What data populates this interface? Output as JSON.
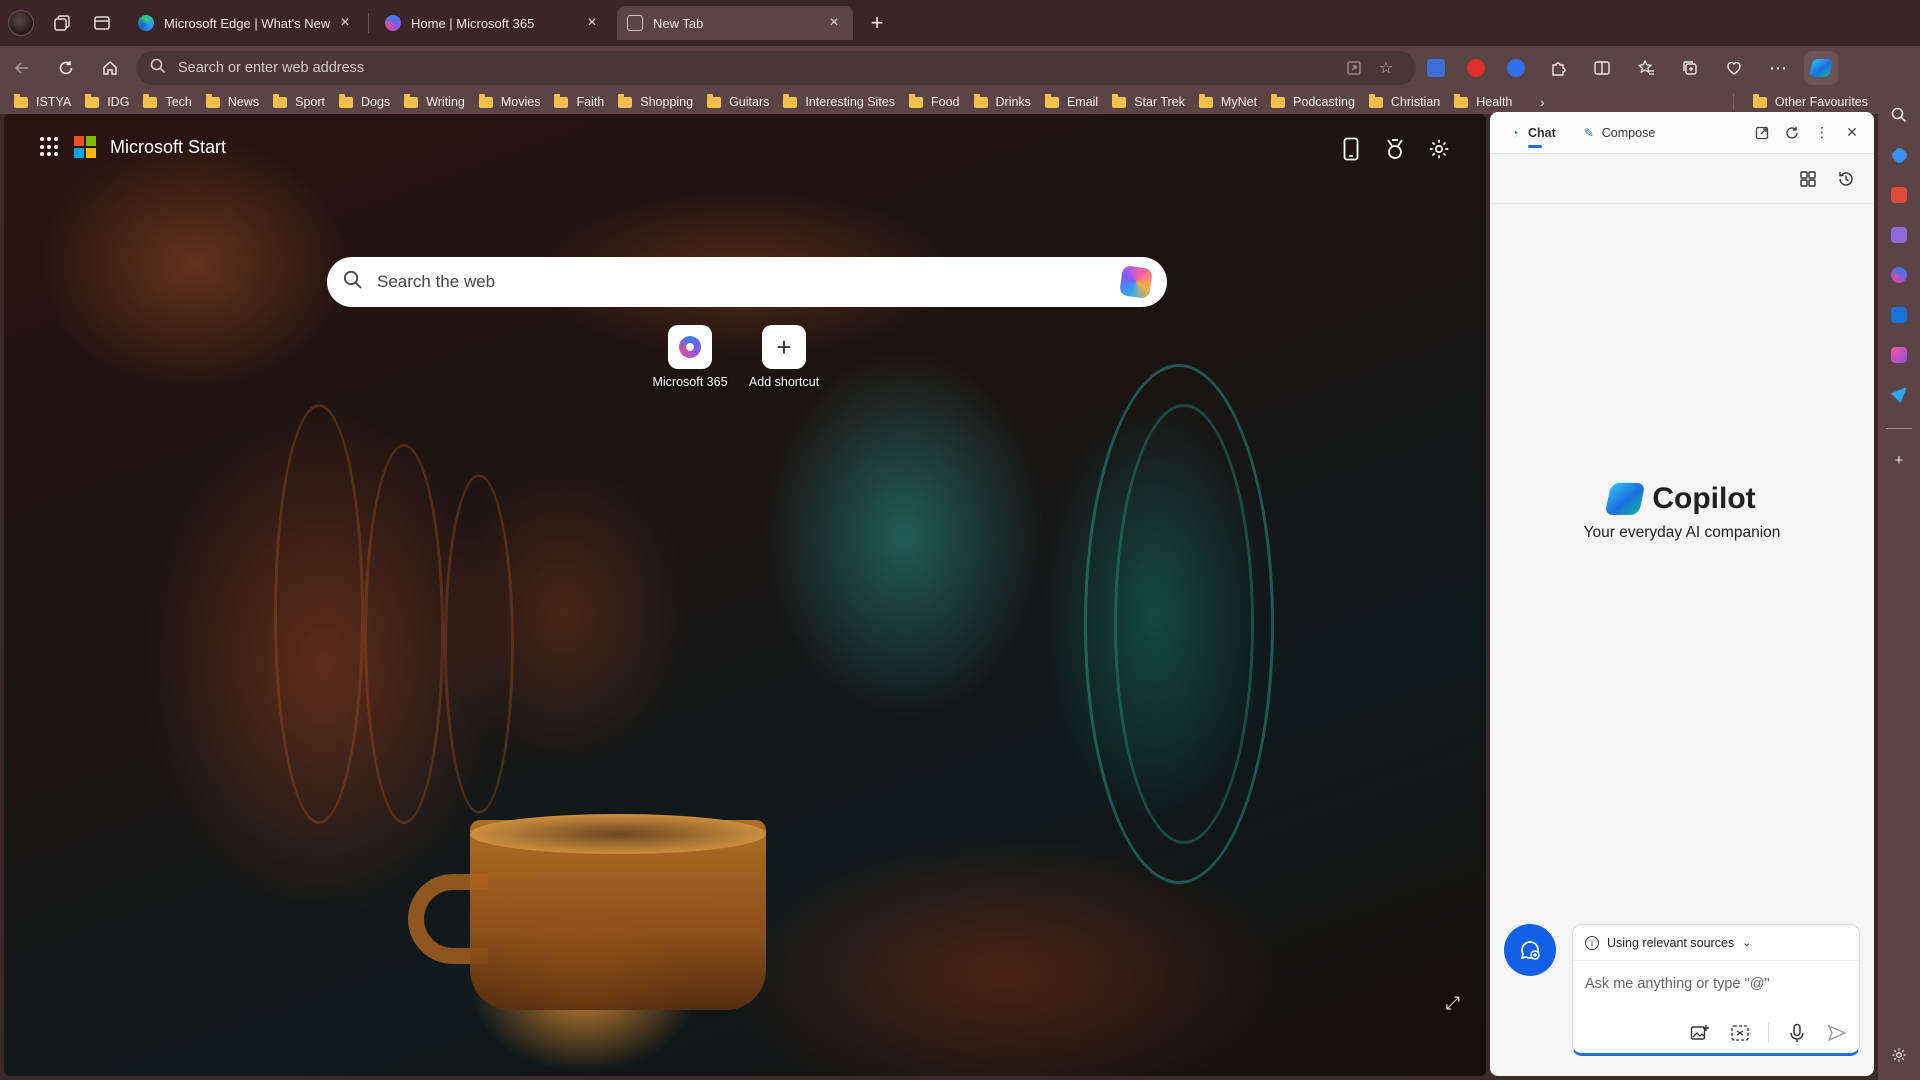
{
  "tabs": [
    {
      "title": "Microsoft Edge | What's New",
      "favicon_color": "#2e9bf0",
      "active": false
    },
    {
      "title": "Home | Microsoft 365",
      "favicon_color": "#7b6cf6",
      "active": false
    },
    {
      "title": "New Tab",
      "favicon_color": "#cfc3c3",
      "active": true
    }
  ],
  "address_bar": {
    "placeholder": "Search or enter web address"
  },
  "favourites": [
    "ISTYA",
    "IDG",
    "Tech",
    "News",
    "Sport",
    "Dogs",
    "Writing",
    "Movies",
    "Faith",
    "Shopping",
    "Guitars",
    "Interesting Sites",
    "Food",
    "Drinks",
    "Email",
    "Star Trek",
    "MyNet",
    "Podcasting",
    "Christian",
    "Health"
  ],
  "other_favourites": "Other Favourites",
  "new_tab_page": {
    "brand": "Microsoft Start",
    "search_placeholder": "Search the web",
    "shortcuts": [
      {
        "label": "Microsoft 365"
      },
      {
        "label": "Add shortcut"
      }
    ]
  },
  "copilot_pane": {
    "tabs": [
      "Chat",
      "Compose"
    ],
    "brand": "Copilot",
    "tagline": "Your everyday AI companion",
    "sources_label": "Using relevant sources",
    "input_placeholder": "Ask me anything or type \"@\""
  },
  "colors": {
    "accent": "#1d6fd8",
    "folder": "#f2c14b",
    "chrome": "#5c4446"
  }
}
